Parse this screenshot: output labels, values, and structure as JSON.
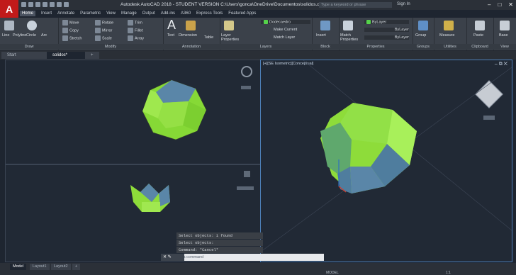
{
  "app": {
    "logo": "A",
    "title": "Autodesk AutoCAD 2018 - STUDENT VERSION   C:\\Users\\gonca\\OneDrive\\Documentos\\solidos.dwg",
    "search_placeholder": "Type a keyword or phrase",
    "signin": "Sign In"
  },
  "menu_tabs": [
    "Home",
    "Insert",
    "Annotate",
    "Parametric",
    "View",
    "Manage",
    "Output",
    "Add-ins",
    "A360",
    "Express Tools",
    "Featured Apps"
  ],
  "ribbon": {
    "draw": {
      "label": "Draw",
      "line": "Line",
      "polyline": "Polyline",
      "circle": "Circle",
      "arc": "Arc"
    },
    "modify": {
      "label": "Modify",
      "move": "Move",
      "rotate": "Rotate",
      "trim": "Trim",
      "copy": "Copy",
      "mirror": "Mirror",
      "fillet": "Fillet",
      "stretch": "Stretch",
      "scale": "Scale",
      "array": "Array"
    },
    "annotation": {
      "label": "Annotation",
      "text": "Text",
      "dimension": "Dimension",
      "table": "Table"
    },
    "layers": {
      "label": "Layers",
      "layer_properties": "Layer Properties",
      "current_layer": "Dodecaedro",
      "make_current": "Make Current",
      "match_layer": "Match Layer"
    },
    "block": {
      "label": "Block",
      "insert": "Insert"
    },
    "properties": {
      "label": "Properties",
      "match_properties": "Match Properties",
      "bylayer1": "ByLayer",
      "bylayer2": "ByLayer",
      "bylayer3": "ByLayer"
    },
    "groups": {
      "label": "Groups",
      "group": "Group"
    },
    "utilities": {
      "label": "Utilities",
      "measure": "Measure"
    },
    "clipboard": {
      "label": "Clipboard",
      "paste": "Paste"
    },
    "view": {
      "label": "View",
      "base": "Base"
    }
  },
  "file_tabs": [
    "Start",
    "solidos*"
  ],
  "viewports": {
    "right_label": "[+][SE Isometric][Conceptual]"
  },
  "command_history": [
    "Select objects: 1 found",
    "Select objects:",
    "Command: *Cancel*"
  ],
  "command_placeholder": "Type a command",
  "layout_tabs": [
    "Model",
    "Layout1",
    "Layout2"
  ],
  "status": {
    "model": "MODEL",
    "scale": "1:1"
  },
  "colors": {
    "green_face": "#8ee03c",
    "blue_face": "#4d7a9a",
    "accent": "#4d7fb8"
  }
}
